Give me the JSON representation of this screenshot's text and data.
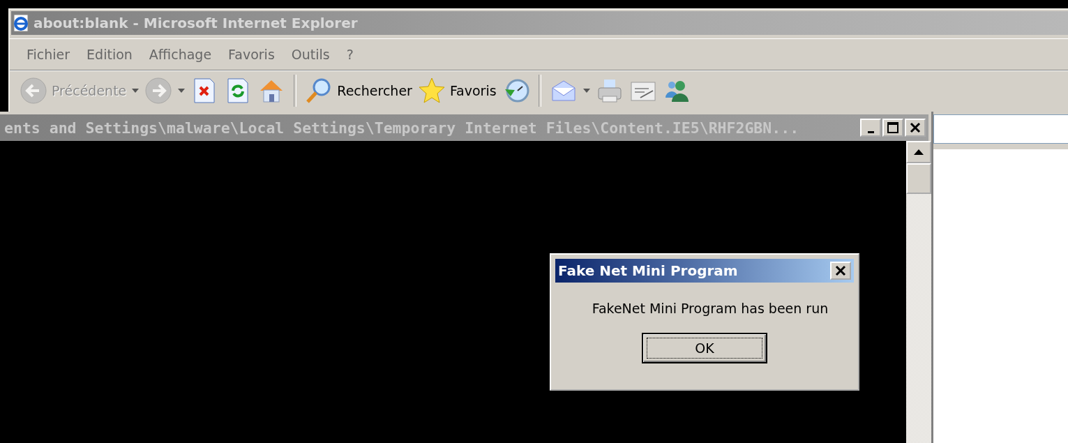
{
  "browser": {
    "title": "about:blank - Microsoft Internet Explorer",
    "menu": [
      "Fichier",
      "Edition",
      "Affichage",
      "Favoris",
      "Outils",
      "?"
    ],
    "toolbar": [
      {
        "kind": "back",
        "label": "Précédente",
        "disabled": true,
        "dropdown": true
      },
      {
        "kind": "forward",
        "disabled": true,
        "dropdown": true
      },
      {
        "kind": "stop"
      },
      {
        "kind": "refresh"
      },
      {
        "kind": "home"
      },
      {
        "kind": "separator"
      },
      {
        "kind": "search",
        "label": "Rechercher"
      },
      {
        "kind": "favorites",
        "label": "Favoris"
      },
      {
        "kind": "history"
      },
      {
        "kind": "separator"
      },
      {
        "kind": "mail",
        "dropdown": true
      },
      {
        "kind": "print"
      },
      {
        "kind": "edit"
      },
      {
        "kind": "messenger"
      }
    ]
  },
  "console_window": {
    "title": "ents and Settings\\malware\\Local Settings\\Temporary Internet Files\\Content.IE5\\RHF2GBN...",
    "active": false
  },
  "dialog": {
    "title": "Fake Net Mini Program",
    "message": "FakeNet Mini Program has been run",
    "button": "OK",
    "active": true
  }
}
